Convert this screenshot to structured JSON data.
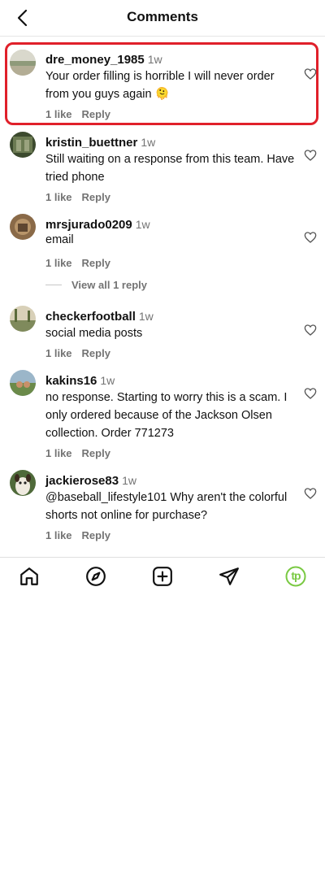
{
  "header": {
    "title": "Comments",
    "back_icon": "chevron-left-icon"
  },
  "comments": [
    {
      "username": "dre_money_1985",
      "time": "1w",
      "text": "Your order filling is horrible I will never order from you guys again 🫠",
      "likes": "1 like",
      "reply": "Reply"
    },
    {
      "username": "kristin_buettner",
      "time": "1w",
      "text": "Still waiting on a response from this team. Have tried phone",
      "likes": "1 like",
      "reply": "Reply"
    },
    {
      "username": "mrsjurado0209",
      "time": "1w",
      "text": "email",
      "likes": "1 like",
      "reply": "Reply",
      "view_replies": "View all 1 reply"
    },
    {
      "username": "checkerfootball",
      "time": "1w",
      "text": "social media posts",
      "likes": "1 like",
      "reply": "Reply"
    },
    {
      "username": "kakins16",
      "time": "1w",
      "text": "no response. Starting to worry this is a scam. I only ordered because of the Jackson Olsen collection. Order 771273",
      "likes": "1 like",
      "reply": "Reply"
    },
    {
      "username": "jackierose83",
      "time": "1w",
      "text": "@baseball_lifestyle101 Why aren't the colorful shorts not online for purchase?",
      "likes": "1 like",
      "reply": "Reply"
    }
  ],
  "bottom_nav": {
    "items": [
      "home-icon",
      "explore-icon",
      "create-icon",
      "direct-icon",
      "profile-icon"
    ],
    "profile_initials": "tp",
    "profile_color": "#7ac943"
  },
  "highlight_color": "#e0202a"
}
